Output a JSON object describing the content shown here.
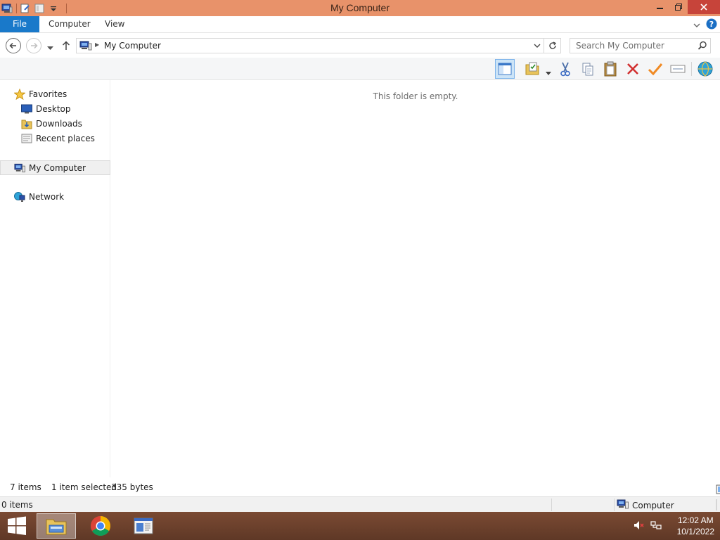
{
  "window": {
    "title": "My Computer",
    "controls": {
      "minimize": "minimize",
      "restore": "restore",
      "close": "close"
    }
  },
  "ribbon": {
    "tabs": [
      {
        "label": "File"
      },
      {
        "label": "Computer"
      },
      {
        "label": "View"
      }
    ]
  },
  "address": {
    "breadcrumb": "My Computer"
  },
  "search": {
    "placeholder": "Search My Computer"
  },
  "toolbar": {
    "buttons": [
      "preview-pane",
      "properties",
      "cut",
      "copy",
      "paste",
      "delete",
      "check",
      "rename",
      "web"
    ]
  },
  "navpane": {
    "favorites_label": "Favorites",
    "favorites": [
      {
        "label": "Desktop"
      },
      {
        "label": "Downloads"
      },
      {
        "label": "Recent places"
      }
    ],
    "computer_label": "My Computer",
    "network_label": "Network"
  },
  "content": {
    "empty_message": "This folder is empty."
  },
  "status": {
    "items_count": "7 items",
    "selected": "1 item selected",
    "size": "335 bytes"
  },
  "lowbar": {
    "left": "0 items",
    "right": "Computer"
  },
  "taskbar": {
    "time": "12:02 AM",
    "date": "10/1/2022"
  },
  "colors": {
    "titlebar": "#e8926a",
    "file_tab": "#1979ca",
    "close_button": "#c7443a",
    "taskbar": "#6b3f2b"
  }
}
